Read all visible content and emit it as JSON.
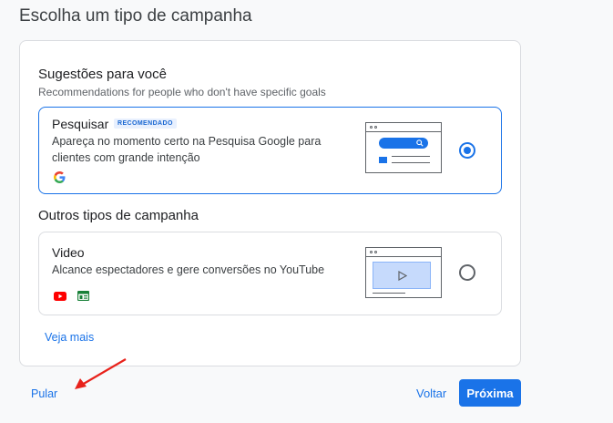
{
  "page": {
    "title": "Escolha um tipo de campanha"
  },
  "suggestions": {
    "title": "Sugestões para você",
    "subtitle": "Recommendations for people who don't have specific goals"
  },
  "search_option": {
    "name": "Pesquisar",
    "badge": "RECOMENDADO",
    "description": "Apareça no momento certo na Pesquisa Google para clientes com grande intenção",
    "selected": true,
    "icons": [
      "google-g-icon"
    ]
  },
  "other_types": {
    "title": "Outros tipos de campanha"
  },
  "video_option": {
    "name": "Video",
    "description": "Alcance espectadores e gere conversões no YouTube",
    "selected": false,
    "icons": [
      "youtube-icon",
      "display-network-icon"
    ]
  },
  "see_more_label": "Veja mais",
  "footer": {
    "skip_label": "Pular",
    "back_label": "Voltar",
    "next_label": "Próxima"
  },
  "colors": {
    "accent": "#1a73e8",
    "badge_bg": "#e8f0fe",
    "annotation_arrow": "#e8221b"
  }
}
